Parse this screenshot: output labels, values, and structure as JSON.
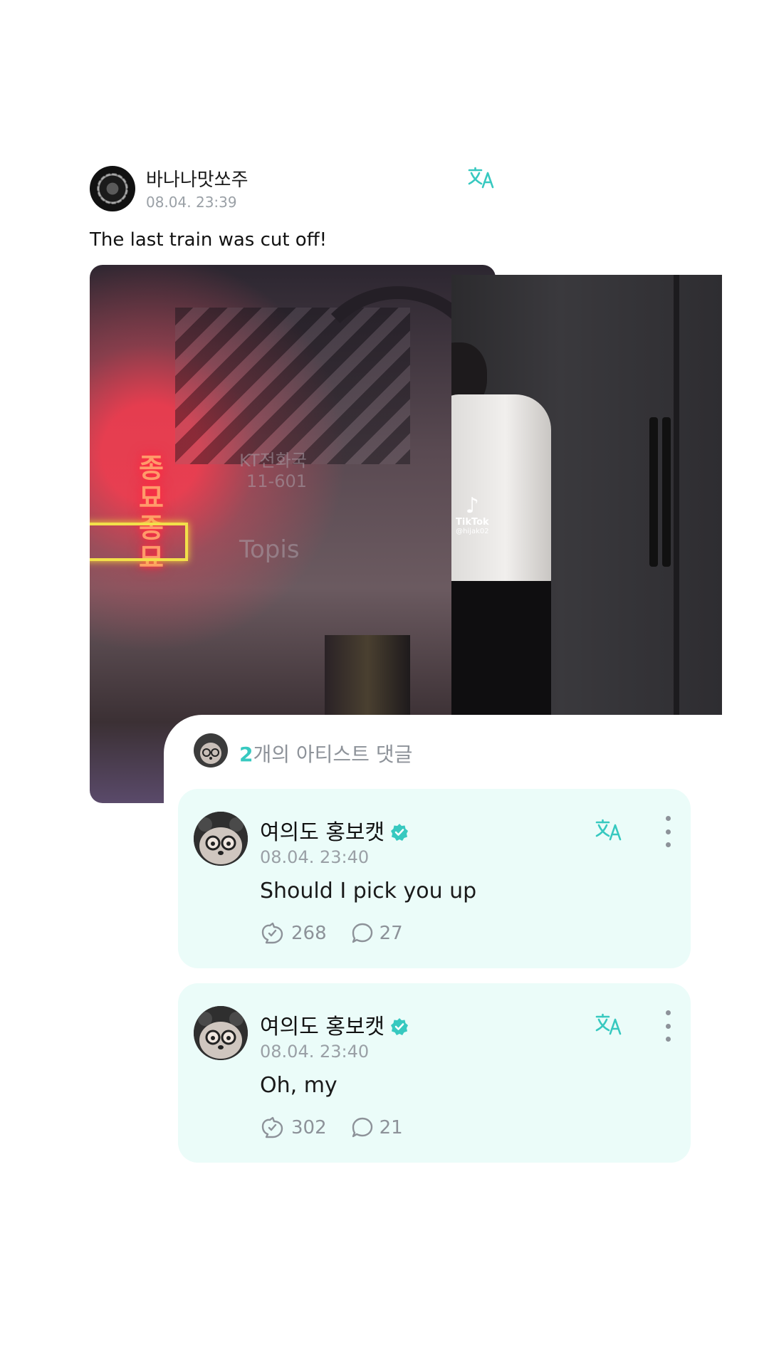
{
  "post": {
    "author": "바나나맛쏘주",
    "timestamp": "08.04. 23:39",
    "text": "The last train was cut off!",
    "translate_icon": "translate-icon"
  },
  "media": {
    "left_image": {
      "sign_text": "종묘종묘",
      "faded_text_1": "KT전화국",
      "faded_text_2": "11-601",
      "faded_text_3": "Topis"
    },
    "right_video": {
      "watermark_brand": "TikTok",
      "watermark_handle": "@hijak02"
    }
  },
  "artist_comments": {
    "count": "2",
    "header_suffix": "개의 아티스트 댓글",
    "items": [
      {
        "author": "여의도 홍보캣",
        "verified": true,
        "timestamp": "08.04. 23:40",
        "text": "Should I pick you up",
        "likes": "268",
        "replies": "27"
      },
      {
        "author": "여의도 홍보캣",
        "verified": true,
        "timestamp": "08.04. 23:40",
        "text": "Oh, my",
        "likes": "302",
        "replies": "21"
      }
    ]
  },
  "colors": {
    "accent": "#37c9c0",
    "card_background": "#ebfcf9",
    "muted_text": "#8d9299"
  }
}
